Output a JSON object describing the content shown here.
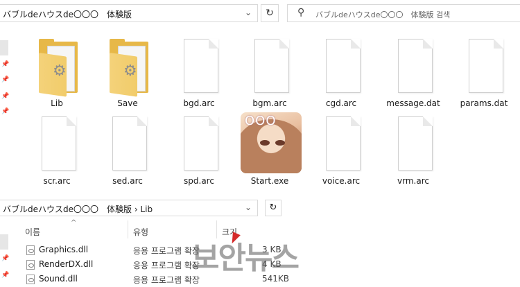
{
  "top_bar": {
    "path": "バブルdeハウスde〇〇〇　体験版",
    "search_placeholder": "バブルdeハウスde〇〇〇　体験版 검색"
  },
  "icons": {
    "dropdown": "chevron-down-icon",
    "refresh": "refresh-icon",
    "search": "search-icon",
    "pin": "pin-icon",
    "folder": "folder-icon",
    "file": "file-icon",
    "dll": "dll-file-icon"
  },
  "top_items": [
    {
      "label": "Lib",
      "kind": "folder"
    },
    {
      "label": "Save",
      "kind": "folder"
    },
    {
      "label": "bgd.arc",
      "kind": "file"
    },
    {
      "label": "bgm.arc",
      "kind": "file"
    },
    {
      "label": "cgd.arc",
      "kind": "file"
    },
    {
      "label": "message.dat",
      "kind": "file"
    },
    {
      "label": "params.dat",
      "kind": "file"
    },
    {
      "label": "scr.arc",
      "kind": "file"
    },
    {
      "label": "sed.arc",
      "kind": "file"
    },
    {
      "label": "spd.arc",
      "kind": "file"
    },
    {
      "label": "Start.exe",
      "kind": "app"
    },
    {
      "label": "voice.arc",
      "kind": "file"
    },
    {
      "label": "vrm.arc",
      "kind": "file"
    }
  ],
  "lower_pane": {
    "path": "バブルdeハウスde〇〇〇　体験版 › Lib",
    "columns": {
      "name": "이름",
      "type": "유형",
      "size": "크기"
    },
    "rows": [
      {
        "name": "Graphics.dll",
        "type": "응용 프로그램 확장",
        "size": "3 KB"
      },
      {
        "name": "RenderDX.dll",
        "type": "응용 프로그램 확장",
        "size": "4 KB"
      },
      {
        "name": "Sound.dll",
        "type": "응용 프로그램 확장",
        "size": "541KB"
      }
    ]
  },
  "app_logo_text": "ООО",
  "watermark": "보안뉴스",
  "colors": {
    "folder": "#e7b848",
    "watermark_mark": "#d42a2a"
  }
}
